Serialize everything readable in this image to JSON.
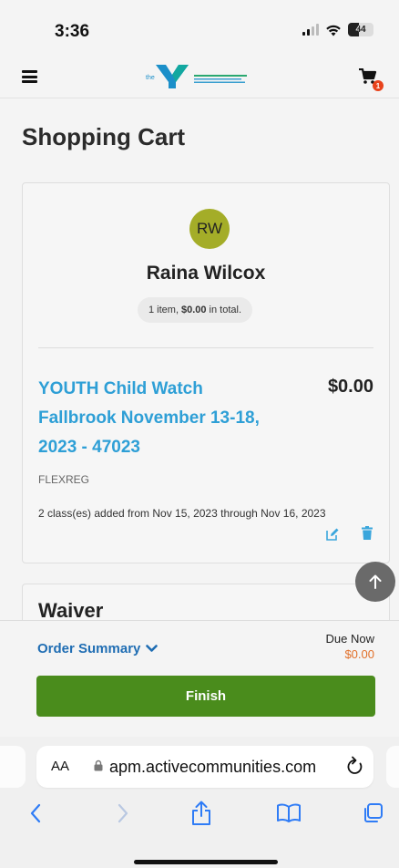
{
  "status_bar": {
    "time": "3:36",
    "battery": "44"
  },
  "header": {
    "cart_count": "1"
  },
  "page": {
    "title": "Shopping Cart"
  },
  "participant": {
    "initials": "RW",
    "name": "Raina Wilcox",
    "summary_prefix": "1 item,",
    "summary_amount": "$0.00",
    "summary_suffix": "in total."
  },
  "cart_item": {
    "title": "YOUTH Child Watch Fallbrook November 13-18, 2023 - 47023",
    "price": "$0.00",
    "code": "FLEXREG",
    "dates_text": "2 class(es) added from Nov 15, 2023 through Nov 16, 2023"
  },
  "waiver": {
    "title": "Waiver"
  },
  "order": {
    "summary_label": "Order Summary",
    "due_label": "Due Now",
    "due_amount": "$0.00",
    "finish_label": "Finish"
  },
  "browser": {
    "aa_label": "AA",
    "url": "apm.activecommunities.com"
  },
  "colors": {
    "link_blue": "#2e9fd6",
    "finish_green": "#4a8c1c",
    "due_orange": "#e1702a",
    "avatar_olive": "#a4ad28"
  }
}
